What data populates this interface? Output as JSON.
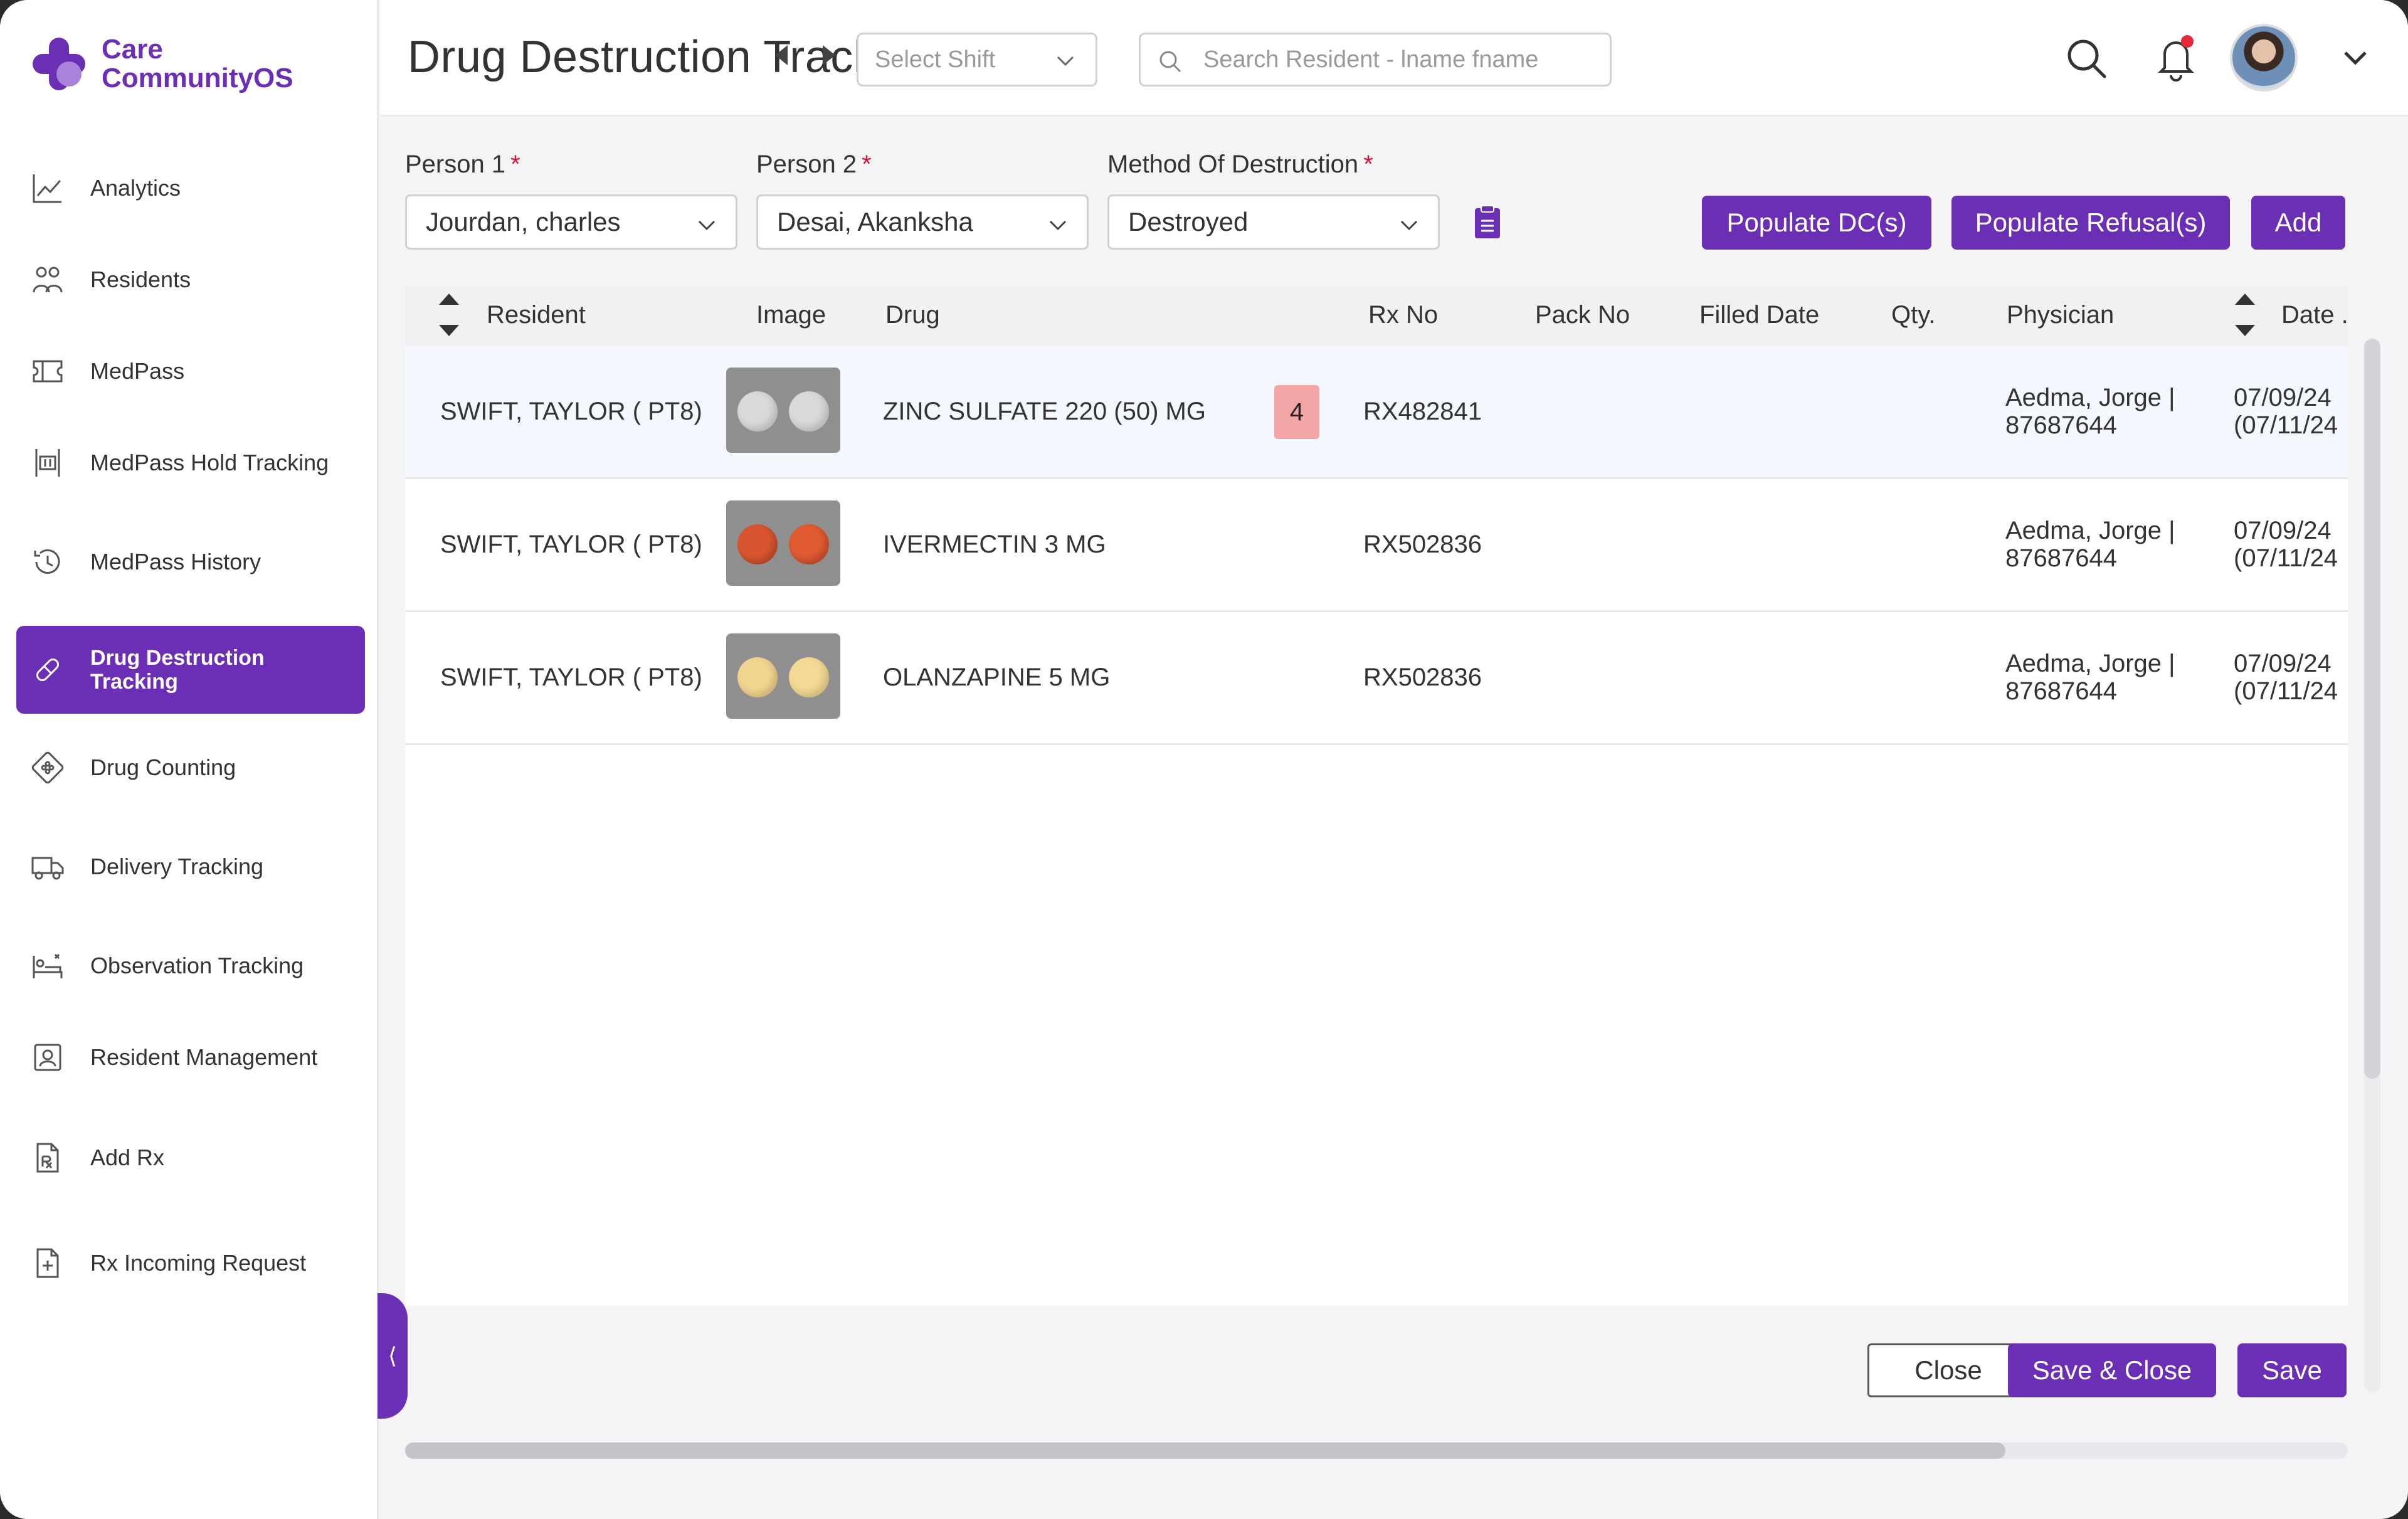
{
  "app": {
    "logo_line1": "Care",
    "logo_line2": "CommunityOS"
  },
  "sidebar": {
    "items": [
      {
        "label": "Analytics",
        "icon": "chart-line-icon"
      },
      {
        "label": "Residents",
        "icon": "users-icon"
      },
      {
        "label": "MedPass",
        "icon": "ticket-icon"
      },
      {
        "label": "MedPass Hold Tracking",
        "icon": "hold-icon"
      },
      {
        "label": "MedPass History",
        "icon": "history-icon"
      },
      {
        "label": "Drug Destruction Tracking",
        "icon": "pill-icon",
        "active": true
      },
      {
        "label": "Drug Counting",
        "icon": "blister-pack-icon"
      },
      {
        "label": "Delivery Tracking",
        "icon": "truck-icon"
      },
      {
        "label": "Observation Tracking",
        "icon": "bed-icon"
      },
      {
        "label": "Resident Management",
        "icon": "id-card-icon"
      },
      {
        "label": "Add Rx",
        "icon": "rx-file-icon"
      },
      {
        "label": "Rx Incoming Request",
        "icon": "file-plus-icon"
      }
    ],
    "collapse_glyph": "⟨"
  },
  "header": {
    "title": "Drug Destruction Tracking",
    "shift_placeholder": "Select Shift",
    "search_placeholder": "Search Resident - lname fname"
  },
  "form": {
    "person1_label": "Person 1",
    "person1_value": "Jourdan, charles",
    "person2_label": "Person 2",
    "person2_value": "Desai, Akanksha",
    "method_label": "Method Of Destruction",
    "method_value": "Destroyed",
    "required_mark": "*",
    "populate_dc": "Populate DC(s)",
    "populate_refusal": "Populate Refusal(s)",
    "add": "Add"
  },
  "table": {
    "columns": [
      "Resident",
      "Image",
      "Drug",
      "Rx No",
      "Pack No",
      "Filled Date",
      "Qty.",
      "Physician",
      "Date ."
    ],
    "rows": [
      {
        "resident": "SWIFT, TAYLOR ( PT8)",
        "drug": "ZINC SULFATE 220 (50) MG",
        "badge": "4",
        "rx_no": "RX482841",
        "pack_no": "",
        "filled_date": "",
        "qty": "",
        "physician_name": "Aedma, Jorge |",
        "physician_id": "87687644",
        "date1": "07/09/24",
        "date2": "(07/11/24",
        "pill_colors": [
          "#d9d9d9",
          "#d9d9d9"
        ]
      },
      {
        "resident": "SWIFT, TAYLOR ( PT8)",
        "drug": "IVERMECTIN 3 MG",
        "badge": "",
        "rx_no": "RX502836",
        "pack_no": "",
        "filled_date": "",
        "qty": "",
        "physician_name": "Aedma, Jorge |",
        "physician_id": "87687644",
        "date1": "07/09/24",
        "date2": "(07/11/24",
        "pill_colors": [
          "#d9552f",
          "#e05a32"
        ]
      },
      {
        "resident": "SWIFT, TAYLOR ( PT8)",
        "drug": "OLANZAPINE 5 MG",
        "badge": "",
        "rx_no": "RX502836",
        "pack_no": "",
        "filled_date": "",
        "qty": "",
        "physician_name": "Aedma, Jorge |",
        "physician_id": "87687644",
        "date1": "07/09/24",
        "date2": "(07/11/24",
        "pill_colors": [
          "#f1d58e",
          "#f3d993"
        ]
      }
    ]
  },
  "footer": {
    "close": "Close",
    "save_close": "Save & Close",
    "save": "Save"
  },
  "colors": {
    "accent": "#6a2fb4",
    "required": "#d2143a",
    "badge": "#f4a6a6",
    "notification_dot": "#e5293b"
  }
}
